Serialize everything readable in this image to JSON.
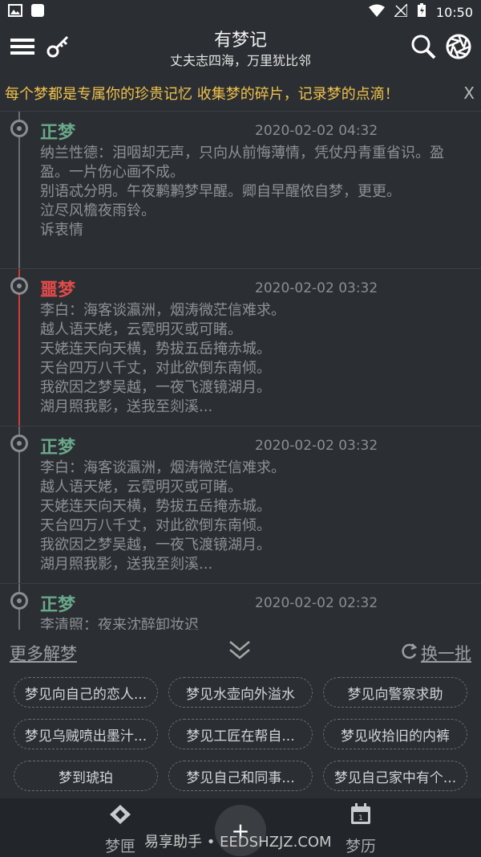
{
  "status": {
    "time": "10:50"
  },
  "header": {
    "title": "有梦记",
    "subtitle": "丈夫志四海，万里犹比邻"
  },
  "marquee": {
    "text": "每个梦都是专属你的珍贵记忆 收集梦的碎片，记录梦的点滴！",
    "close": "X"
  },
  "dreams": [
    {
      "kind": "正梦",
      "time": "2020-02-02 04:32",
      "content": "纳兰性德：泪咽却无声，只向从前悔薄情，凭仗丹青重省识。盈盈。一片伤心画不成。\n别语忒分明。午夜鹣鹣梦早醒。卿自早醒侬自梦，更更。\n泣尽风檐夜雨铃。\n诉衷情"
    },
    {
      "kind": "噩梦",
      "time": "2020-02-02 03:32",
      "content": "李白：海客谈瀛洲，烟涛微茫信难求。\n越人语天姥，云霓明灭或可睹。\n天姥连天向天横，势拔五岳掩赤城。\n天台四万八千丈，对此欲倒东南倾。\n我欲因之梦吴越，一夜飞渡镜湖月。\n湖月照我影，送我至剡溪..."
    },
    {
      "kind": "正梦",
      "time": "2020-02-02 03:32",
      "content": "李白：海客谈瀛洲，烟涛微茫信难求。\n越人语天姥，云霓明灭或可睹。\n天姥连天向天横，势拔五岳掩赤城。\n天台四万八千丈，对此欲倒东南倾。\n我欲因之梦吴越，一夜飞渡镜湖月。\n湖月照我影，送我至剡溪..."
    },
    {
      "kind": "正梦",
      "time": "2020-02-02 02:32",
      "content": "李清照：夜来沈醉卸妆迟"
    }
  ],
  "more": {
    "left": "更多解梦",
    "right": "换一批"
  },
  "chips": [
    "梦见向自己的恋人...",
    "梦见水壶向外溢水",
    "梦见向警察求助",
    "梦见乌贼喷出墨汁...",
    "梦见工匠在帮自...",
    "梦见收拾旧的内裤",
    "梦到琥珀",
    "梦见自己和同事...",
    "梦见自己家中有个..."
  ],
  "tabs": {
    "left": "梦匣",
    "right": "梦历"
  },
  "fab": {
    "label": "+"
  },
  "watermark": "易享助手 • EEDSHZJZ.COM"
}
